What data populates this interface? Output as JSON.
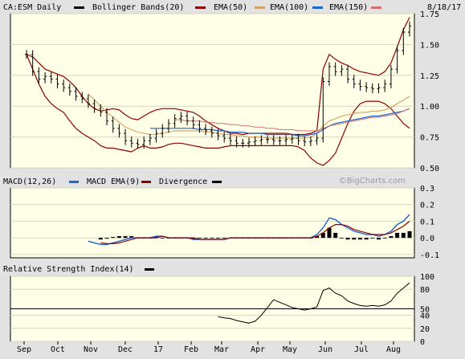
{
  "chart_data": [
    {
      "type": "ohlc",
      "title_parts": {
        "ticker": "CA:ESM Daily",
        "bb": "Bollinger Bands(20)",
        "ema50": "EMA(50)",
        "ema100": "EMA(100)",
        "ema150": "EMA(150)"
      },
      "date_label": "8/18/17",
      "watermark": "©BigCharts.com",
      "x_labels": [
        "Sep",
        "Oct",
        "Nov",
        "Dec",
        "17",
        "Feb",
        "Mar",
        "Apr",
        "May",
        "Jun",
        "Jul",
        "Aug"
      ],
      "y_ticks": [
        "1.75",
        "1.50",
        "1.25",
        "1.00",
        "0.75",
        "0.50"
      ],
      "y_tick_values": [
        1.75,
        1.5,
        1.25,
        1.0,
        0.75,
        0.5
      ],
      "ylim": [
        0.5,
        1.75
      ],
      "series_colors": {
        "price": "#000000",
        "bb": "#8b0000",
        "ema50": "#8b0000",
        "ema100": "#d2a060",
        "ema150": "#1e64d2",
        "divergence": "#000000"
      },
      "price_closes": [
        1.42,
        1.28,
        1.22,
        1.24,
        1.22,
        1.18,
        1.15,
        1.12,
        1.08,
        1.06,
        1.02,
        0.98,
        0.95,
        0.88,
        0.82,
        0.78,
        0.72,
        0.7,
        0.69,
        0.72,
        0.74,
        0.78,
        0.82,
        0.86,
        0.9,
        0.92,
        0.88,
        0.85,
        0.82,
        0.8,
        0.78,
        0.76,
        0.74,
        0.72,
        0.7,
        0.7,
        0.71,
        0.72,
        0.73,
        0.73,
        0.72,
        0.72,
        0.73,
        0.74,
        0.72,
        0.71,
        0.72,
        0.74,
        1.2,
        1.32,
        1.28,
        1.3,
        1.22,
        1.18,
        1.16,
        1.15,
        1.14,
        1.15,
        1.18,
        1.3,
        1.45,
        1.6,
        1.65
      ],
      "bb_upper": [
        1.42,
        1.4,
        1.35,
        1.3,
        1.28,
        1.26,
        1.24,
        1.2,
        1.15,
        1.08,
        1.02,
        0.98,
        0.96,
        0.97,
        0.98,
        0.97,
        0.93,
        0.9,
        0.89,
        0.92,
        0.95,
        0.97,
        0.98,
        0.98,
        0.98,
        0.97,
        0.96,
        0.95,
        0.92,
        0.88,
        0.85,
        0.82,
        0.8,
        0.78,
        0.78,
        0.77,
        0.78,
        0.78,
        0.78,
        0.78,
        0.78,
        0.78,
        0.78,
        0.77,
        0.77,
        0.77,
        0.78,
        0.8,
        1.3,
        1.42,
        1.38,
        1.35,
        1.33,
        1.3,
        1.28,
        1.27,
        1.26,
        1.25,
        1.28,
        1.35,
        1.48,
        1.62,
        1.72
      ],
      "bb_lower": [
        1.42,
        1.3,
        1.18,
        1.08,
        1.02,
        0.98,
        0.95,
        0.88,
        0.82,
        0.78,
        0.75,
        0.72,
        0.68,
        0.66,
        0.66,
        0.65,
        0.64,
        0.63,
        0.66,
        0.68,
        0.66,
        0.66,
        0.67,
        0.69,
        0.7,
        0.7,
        0.69,
        0.68,
        0.67,
        0.66,
        0.66,
        0.66,
        0.67,
        0.68,
        0.68,
        0.68,
        0.68,
        0.68,
        0.68,
        0.68,
        0.68,
        0.68,
        0.68,
        0.68,
        0.67,
        0.64,
        0.58,
        0.54,
        0.52,
        0.56,
        0.62,
        0.74,
        0.86,
        0.96,
        1.02,
        1.04,
        1.04,
        1.04,
        1.02,
        0.98,
        0.92,
        0.86,
        0.82
      ],
      "ema50": [
        null,
        null,
        null,
        null,
        null,
        null,
        null,
        null,
        null,
        null,
        1.1,
        1.05,
        1.0,
        0.95,
        0.91,
        0.87,
        0.83,
        0.81,
        0.79,
        0.78,
        0.77,
        0.77,
        0.78,
        0.79,
        0.8,
        0.8,
        0.8,
        0.8,
        0.8,
        0.79,
        0.79,
        0.78,
        0.77,
        0.77,
        0.76,
        0.76,
        0.75,
        0.75,
        0.75,
        0.74,
        0.74,
        0.74,
        0.74,
        0.74,
        0.74,
        0.74,
        0.75,
        0.78,
        0.84,
        0.88,
        0.9,
        0.92,
        0.93,
        0.94,
        0.95,
        0.95,
        0.96,
        0.96,
        0.97,
        0.99,
        1.02,
        1.05,
        1.08
      ],
      "ema100": [
        null,
        null,
        null,
        null,
        null,
        null,
        null,
        null,
        null,
        null,
        null,
        null,
        null,
        null,
        null,
        null,
        null,
        null,
        null,
        null,
        0.82,
        0.82,
        0.82,
        0.82,
        0.82,
        0.82,
        0.82,
        0.82,
        0.81,
        0.81,
        0.81,
        0.8,
        0.8,
        0.79,
        0.79,
        0.79,
        0.78,
        0.78,
        0.78,
        0.77,
        0.77,
        0.77,
        0.77,
        0.77,
        0.76,
        0.76,
        0.77,
        0.78,
        0.81,
        0.84,
        0.86,
        0.87,
        0.88,
        0.89,
        0.9,
        0.91,
        0.92,
        0.92,
        0.93,
        0.94,
        0.95,
        0.96,
        0.98
      ],
      "ema150": [
        null,
        null,
        null,
        null,
        null,
        null,
        null,
        null,
        null,
        null,
        null,
        null,
        null,
        null,
        null,
        null,
        null,
        null,
        null,
        null,
        null,
        null,
        null,
        null,
        0.89,
        0.89,
        0.88,
        0.88,
        0.88,
        0.87,
        0.87,
        0.86,
        0.86,
        0.85,
        0.85,
        0.84,
        0.84,
        0.83,
        0.83,
        0.82,
        0.82,
        0.81,
        0.81,
        0.81,
        0.8,
        0.8,
        0.8,
        0.8,
        0.82,
        0.84,
        0.85,
        0.86,
        0.87,
        0.88,
        0.89,
        0.9,
        0.91,
        0.91,
        0.92,
        0.93,
        0.94,
        0.96,
        0.98
      ]
    },
    {
      "type": "macd",
      "title_parts": {
        "macd": "MACD(12,26)",
        "signal": "MACD EMA(9)",
        "divergence": "Divergence"
      },
      "y_ticks": [
        "0.3",
        "0.2",
        "0.1",
        "0.0",
        "-0.1"
      ],
      "y_tick_values": [
        0.3,
        0.2,
        0.1,
        0.0,
        -0.1
      ],
      "ylim": [
        -0.12,
        0.3
      ],
      "macd": [
        null,
        null,
        null,
        null,
        null,
        null,
        null,
        null,
        null,
        null,
        -0.02,
        -0.03,
        -0.04,
        -0.04,
        -0.03,
        -0.02,
        -0.01,
        0.0,
        0.0,
        0.0,
        0.0,
        0.01,
        0.01,
        0.0,
        0.0,
        0.0,
        0.0,
        -0.01,
        -0.01,
        -0.01,
        -0.01,
        -0.01,
        -0.01,
        0.0,
        0.0,
        0.0,
        0.0,
        0.0,
        0.0,
        0.0,
        0.0,
        0.0,
        0.0,
        0.0,
        0.0,
        0.0,
        0.0,
        0.02,
        0.06,
        0.12,
        0.11,
        0.08,
        0.06,
        0.04,
        0.03,
        0.02,
        0.02,
        0.01,
        0.02,
        0.04,
        0.08,
        0.1,
        0.14
      ],
      "signal": [
        null,
        null,
        null,
        null,
        null,
        null,
        null,
        null,
        null,
        null,
        null,
        null,
        -0.03,
        -0.035,
        -0.035,
        -0.03,
        -0.02,
        -0.01,
        0.0,
        0.0,
        0.0,
        0.0,
        0.01,
        0.0,
        0.0,
        0.0,
        0.0,
        0.0,
        -0.01,
        -0.01,
        -0.01,
        -0.01,
        -0.01,
        0.0,
        0.0,
        0.0,
        0.0,
        0.0,
        0.0,
        0.0,
        0.0,
        0.0,
        0.0,
        0.0,
        0.0,
        0.0,
        0.0,
        0.01,
        0.03,
        0.06,
        0.08,
        0.08,
        0.07,
        0.05,
        0.04,
        0.03,
        0.02,
        0.02,
        0.02,
        0.03,
        0.05,
        0.07,
        0.1
      ]
    },
    {
      "type": "line",
      "title": "Relative Strength Index(14)",
      "y_ticks": [
        "100",
        "80",
        "50",
        "40",
        "20",
        "0"
      ],
      "y_tick_values": [
        100,
        80,
        50,
        40,
        20,
        0
      ],
      "ylim": [
        0,
        100
      ],
      "reference_line": 50,
      "rsi": [
        null,
        null,
        null,
        null,
        null,
        null,
        null,
        null,
        null,
        null,
        null,
        null,
        null,
        null,
        null,
        null,
        null,
        null,
        null,
        null,
        null,
        null,
        null,
        null,
        null,
        null,
        null,
        null,
        null,
        null,
        null,
        38,
        36,
        35,
        32,
        30,
        28,
        31,
        40,
        52,
        64,
        60,
        56,
        52,
        50,
        48,
        50,
        53,
        78,
        82,
        74,
        70,
        62,
        58,
        55,
        54,
        55,
        54,
        56,
        62,
        74,
        82,
        90
      ]
    }
  ]
}
